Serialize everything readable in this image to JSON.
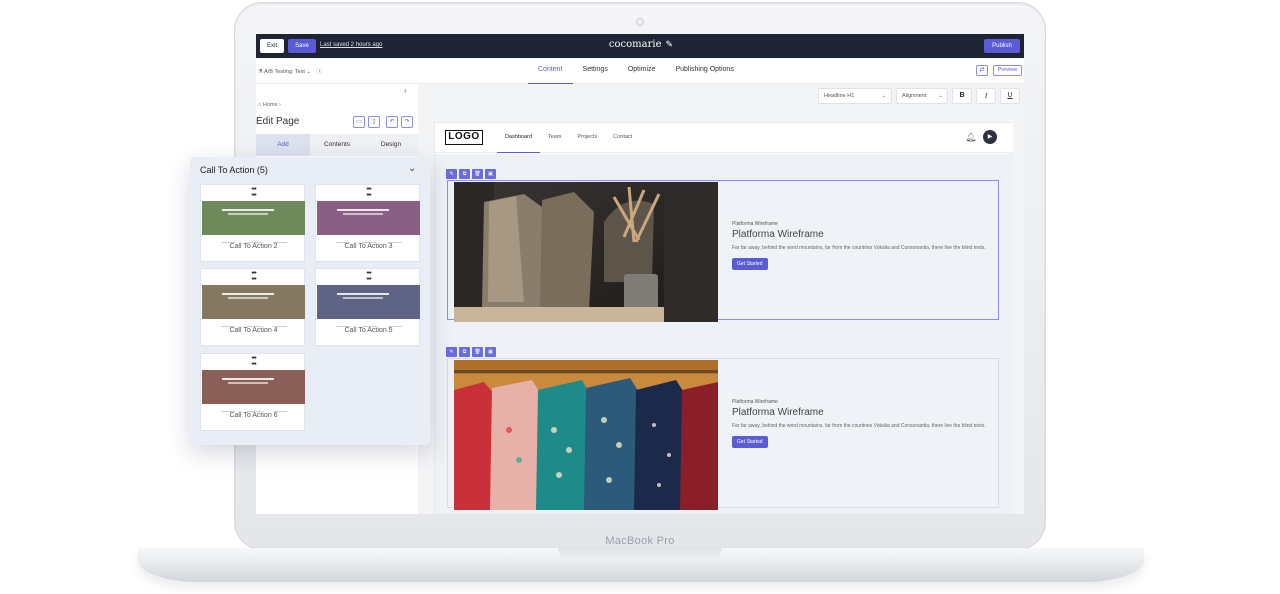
{
  "device": {
    "brand": "MacBook Pro"
  },
  "editor": {
    "topbar": {
      "exit_label": "Exit",
      "save_label": "Save",
      "last_saved": "Last saved 2 hours ago",
      "site_name": "cocomarie",
      "publish_label": "Publish"
    },
    "subbar": {
      "ab_testing": "A/B Testing: Test",
      "tabs": [
        {
          "label": "Content",
          "active": true
        },
        {
          "label": "Settings",
          "active": false
        },
        {
          "label": "Optimize",
          "active": false
        },
        {
          "label": "Publishing Options",
          "active": false
        }
      ],
      "preview_label": "Preview"
    },
    "left_panel": {
      "breadcrumb": "Home",
      "title": "Edit Page",
      "tabs": [
        {
          "label": "Add",
          "active": true
        },
        {
          "label": "Contents",
          "active": false
        },
        {
          "label": "Design",
          "active": false
        }
      ]
    },
    "format_toolbar": {
      "heading_select": "Headline H1",
      "alignment_select": "Alignment",
      "bold": "B",
      "italic": "I",
      "underline": "U"
    }
  },
  "site": {
    "logo": "LOGO",
    "nav": [
      {
        "label": "Dashboard",
        "active": true
      },
      {
        "label": "Team",
        "active": false
      },
      {
        "label": "Projects",
        "active": false
      },
      {
        "label": "Contact",
        "active": false
      }
    ],
    "sections": [
      {
        "kicker": "Platforma Wireframe",
        "heading": "Platforma Wireframe",
        "body": "Far far away, behind the word mountains, far from the countries Vokalia and Consonantia, there live the blind texts.",
        "cta": "Get Started"
      },
      {
        "kicker": "Platforma Wireframe",
        "heading": "Platforma Wireframe",
        "body": "Far far away, behind the word mountains, far from the countries Vokalia and Consonantia, there live the blind texts.",
        "cta": "Get Started"
      }
    ]
  },
  "cta_panel": {
    "title": "Call To Action (5)",
    "cards": [
      {
        "label": "Call To Action 2",
        "color": "#6e8a5a"
      },
      {
        "label": "Call To Action 3",
        "color": "#8a5f86"
      },
      {
        "label": "Call To Action 4",
        "color": "#857860"
      },
      {
        "label": "Call To Action 5",
        "color": "#5f6384"
      },
      {
        "label": "Call To Action 6",
        "color": "#8a5f58"
      }
    ]
  },
  "colors": {
    "accent": "#5b5bd6",
    "topbar": "#1e2433"
  }
}
